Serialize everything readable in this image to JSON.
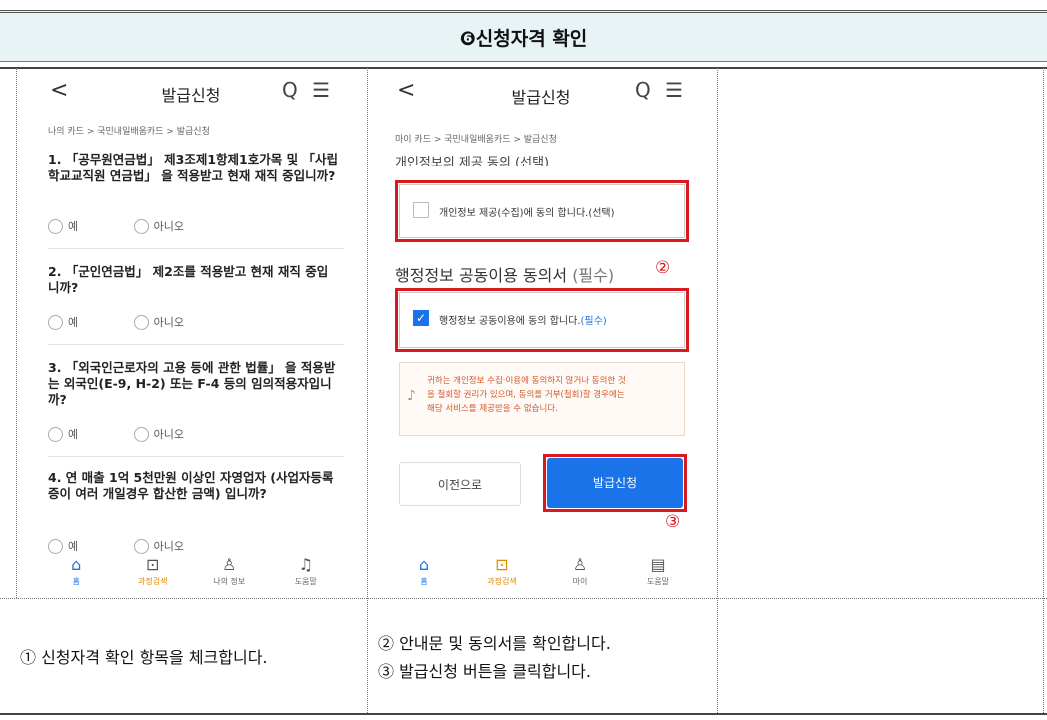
{
  "title": "❻신청자격 확인",
  "left_phone": {
    "back": "<",
    "header": "발급신청",
    "icons": "Q ☰",
    "breadcrumb": "나의 카드 > 국민내일배움카드 > 발급신청",
    "questions": [
      {
        "text": "1. 「공무원연금법」 제3조제1항제1호가목 및 「사립학교교직원 연금법」 을 적용받고 현재 재직 중입니까?",
        "yes": "예",
        "no": "아니오"
      },
      {
        "text": "2. 「군인연금법」 제2조를 적용받고 현재 재직 중입니까?",
        "yes": "예",
        "no": "아니오"
      },
      {
        "text": "3. 「외국인근로자의 고용 등에 관한 법률」 을 적용받는 외국인(E-9, H-2) 또는 F-4 등의 임의적용자입니까?",
        "yes": "예",
        "no": "아니오"
      },
      {
        "text": "4. 연 매출 1억 5천만원 이상인 자영업자 (사업자등록증이 여러 개일경우 합산한 금액) 입니까?",
        "yes": "예",
        "no": "아니오"
      }
    ],
    "nav": [
      {
        "icon": "home-icon",
        "label": "홈"
      },
      {
        "icon": "search-doc-icon",
        "label": "과정검색"
      },
      {
        "icon": "person-icon",
        "label": "나의 정보"
      },
      {
        "icon": "bell-icon",
        "label": "도움말"
      }
    ]
  },
  "right_phone": {
    "back": "<",
    "header": "발급신청",
    "icons": "Q ☰",
    "breadcrumb": "마이 카드 > 국민내일배움카드 > 발급신청",
    "partial_heading": "개인정보의 제공 동의 (선택)",
    "optional_consent": "개인정보 제공(수집)에 동의 합니다.(선택)",
    "section_heading": "행정정보 공동이용 동의서",
    "section_required": "(필수)",
    "required_consent": "행정정보 공동이용에 동의 합니다.",
    "required_tag": "(필수)",
    "notice_lines": [
      "귀하는 개인정보 수집·이용에 동의하지 않거나 동의한 것",
      "을 철회할 권리가 있으며, 동의를 거부(철회)할 경우에는",
      "해당 서비스를 제공받을 수 없습니다."
    ],
    "btn_prev": "이전으로",
    "btn_apply": "발급신청",
    "marker_2": "②",
    "marker_3": "③",
    "nav": [
      {
        "icon": "home-icon",
        "label": "홈"
      },
      {
        "icon": "search-doc-icon",
        "label": "과정검색"
      },
      {
        "icon": "person-icon",
        "label": "마이"
      },
      {
        "icon": "book-icon",
        "label": "도움말"
      }
    ]
  },
  "captions": {
    "left": "① 신청자격 확인 항목을 체크합니다.",
    "right_1": "② 안내문 및 동의서를 확인합니다.",
    "right_2": "③ 발급신청 버튼을 클릭합니다."
  },
  "colors": {
    "accent_blue": "#1a73e8",
    "highlight_red": "#d71920",
    "title_bg": "#e8f3f5"
  }
}
